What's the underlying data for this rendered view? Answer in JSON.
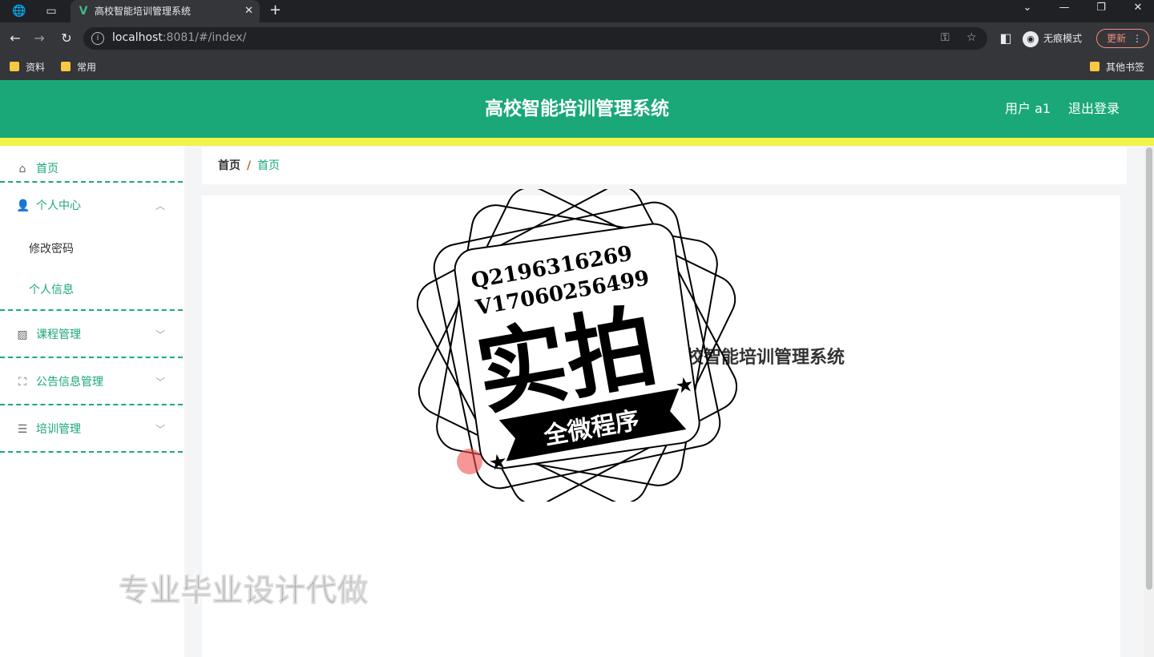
{
  "browser": {
    "tab_title": "高校智能培训管理系统",
    "url_host": "localhost",
    "url_rest": ":8081/#/index/",
    "incognito_label": "无痕模式",
    "update_label": "更新",
    "bookmarks": [
      "资料",
      "常用"
    ],
    "other_bookmarks": "其他书签"
  },
  "header": {
    "title": "高校智能培训管理系统",
    "user_label": "用户 a1",
    "logout_label": "退出登录"
  },
  "sidebar": {
    "home": "首页",
    "personal_center": "个人中心",
    "change_password": "修改密码",
    "personal_info": "个人信息",
    "course_mgmt": "课程管理",
    "notice_mgmt": "公告信息管理",
    "training_mgmt": "培训管理"
  },
  "breadcrumb": {
    "root": "首页",
    "sep": "/",
    "current": "首页"
  },
  "main": {
    "welcome": "欢迎使用高校智能培训管理系统"
  },
  "overlay": {
    "contact_q": "Q2196316269",
    "contact_v": "V17060256499",
    "stamp_big": "实拍",
    "stamp_ribbon": "全微程序",
    "promo": "专业毕业设计代做"
  },
  "colors": {
    "primary": "#1aa878",
    "accent_bar": "#f2f24a"
  }
}
